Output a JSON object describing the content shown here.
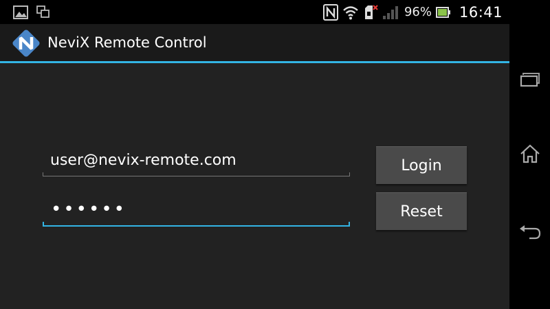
{
  "status_bar": {
    "battery_percent": "96%",
    "clock": "16:41",
    "icons": [
      "gallery-icon",
      "screen-mirror-icon",
      "nfc-icon",
      "wifi-icon",
      "sim-error-icon",
      "signal-icon",
      "battery-icon"
    ]
  },
  "action_bar": {
    "title": "NeviX Remote Control",
    "accent_color": "#33b5e5"
  },
  "login_form": {
    "email_value": "user@nevix-remote.com",
    "password_mask": "••••••"
  },
  "buttons": {
    "login_label": "Login",
    "reset_label": "Reset"
  },
  "nav_bar": {
    "icons": [
      "recent-apps-icon",
      "home-icon",
      "back-icon"
    ]
  }
}
